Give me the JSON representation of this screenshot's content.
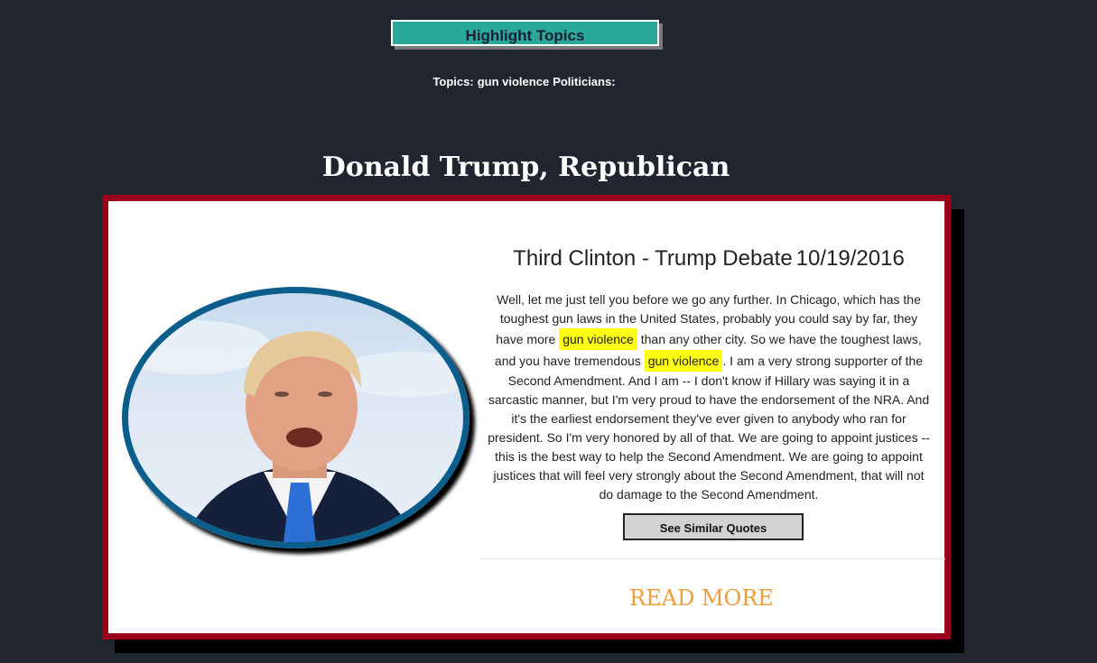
{
  "header": {
    "highlight_button_label": "Highlight Topics",
    "topics_label": "Topics:",
    "topics_value": "gun violence",
    "politicians_label": "Politicians:"
  },
  "speaker": {
    "name": "Donald Trump, Republican"
  },
  "card": {
    "debate_title": "Third Clinton - Trump Debate",
    "debate_date": "10/19/2016",
    "quote": {
      "part1": "Well, let me just tell you before we go any further. In Chicago, which has the toughest gun laws in the United States, probably you could say by far, they have more ",
      "highlight1": "gun violence",
      "part2": " than any other city. So we have the toughest laws, and you have tremendous ",
      "highlight2": "gun violence",
      "part3": ". I am a very strong supporter of the Second Amendment. And I am -- I don't know if Hillary was saying it in a sarcastic manner, but I'm very proud to have the endorsement of the NRA. And it's the earliest endorsement they've ever given to anybody who ran for president. So I'm very honored by all of that. We are going to appoint justices -- this is the best way to help the Second Amendment. We are going to appoint justices that will feel very strongly about the Second Amendment, that will not do damage to the Second Amendment."
    },
    "similar_button_label": "See Similar Quotes",
    "read_more_label": "READ MORE"
  },
  "colors": {
    "background": "#20252f",
    "highlight_button": "#2aa99b",
    "card_border": "#98001c",
    "photo_border": "#0b5e8c",
    "highlight": "#ffff14",
    "read_more": "#f19d37"
  }
}
